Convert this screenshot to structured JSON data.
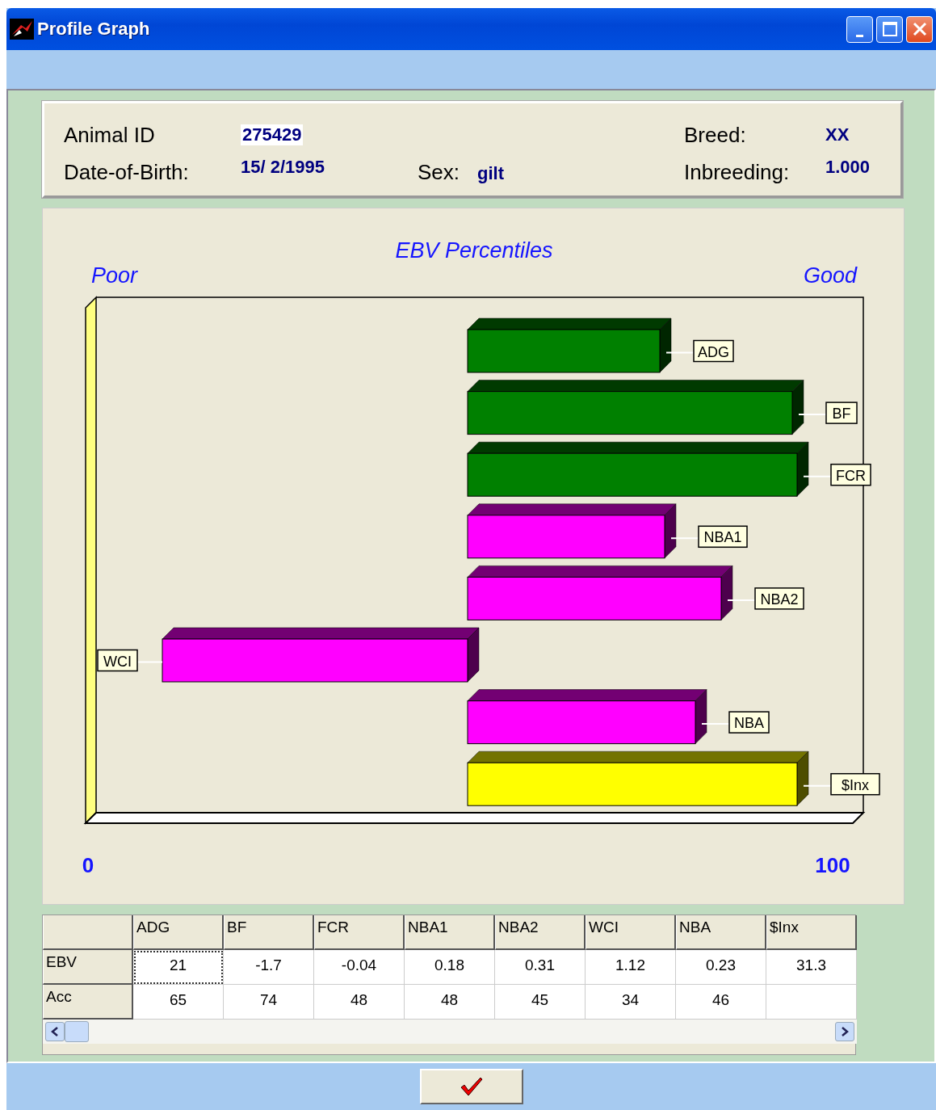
{
  "window": {
    "title": "Profile Graph"
  },
  "header": {
    "animal_id": {
      "label": "Animal ID",
      "value": "275429"
    },
    "date_of_birth": {
      "label": "Date-of-Birth:",
      "value": "15/ 2/1995"
    },
    "sex": {
      "label": "Sex:",
      "value": "gilt"
    },
    "breed": {
      "label": "Breed:",
      "value": "XX"
    },
    "inbreeding": {
      "label": "Inbreeding:",
      "value": "1.000"
    }
  },
  "chart": {
    "title": "EBV Percentiles",
    "left_label": "Poor",
    "right_label": "Good",
    "axis_min": "0",
    "axis_max": "100",
    "bars": [
      {
        "label": "ADG",
        "color": "#008000"
      },
      {
        "label": "BF",
        "color": "#008000"
      },
      {
        "label": "FCR",
        "color": "#008000"
      },
      {
        "label": "NBA1",
        "color": "#ff00ff"
      },
      {
        "label": "NBA2",
        "color": "#ff00ff"
      },
      {
        "label": "WCI",
        "color": "#ff00ff"
      },
      {
        "label": "NBA",
        "color": "#ff00ff"
      },
      {
        "label": "$Inx",
        "color": "#ffff00"
      }
    ]
  },
  "table": {
    "columns": [
      "ADG",
      "BF",
      "FCR",
      "NBA1",
      "NBA2",
      "WCI",
      "NBA",
      "$Inx"
    ],
    "rows": [
      {
        "label": "EBV",
        "cells": [
          {
            "text": "21",
            "selected": true
          },
          {
            "text": "-1.7",
            "selected": false
          },
          {
            "text": "-0.04",
            "selected": false
          },
          {
            "text": "0.18",
            "selected": false
          },
          {
            "text": "0.31",
            "selected": false
          },
          {
            "text": "1.12",
            "selected": false
          },
          {
            "text": "0.23",
            "selected": false
          },
          {
            "text": "31.3",
            "selected": false
          }
        ]
      },
      {
        "label": "Acc",
        "cells": [
          {
            "text": "65",
            "selected": false
          },
          {
            "text": "74",
            "selected": false
          },
          {
            "text": "48",
            "selected": false
          },
          {
            "text": "48",
            "selected": false
          },
          {
            "text": "45",
            "selected": false
          },
          {
            "text": "34",
            "selected": false
          },
          {
            "text": "46",
            "selected": false
          }
        ]
      }
    ]
  }
}
